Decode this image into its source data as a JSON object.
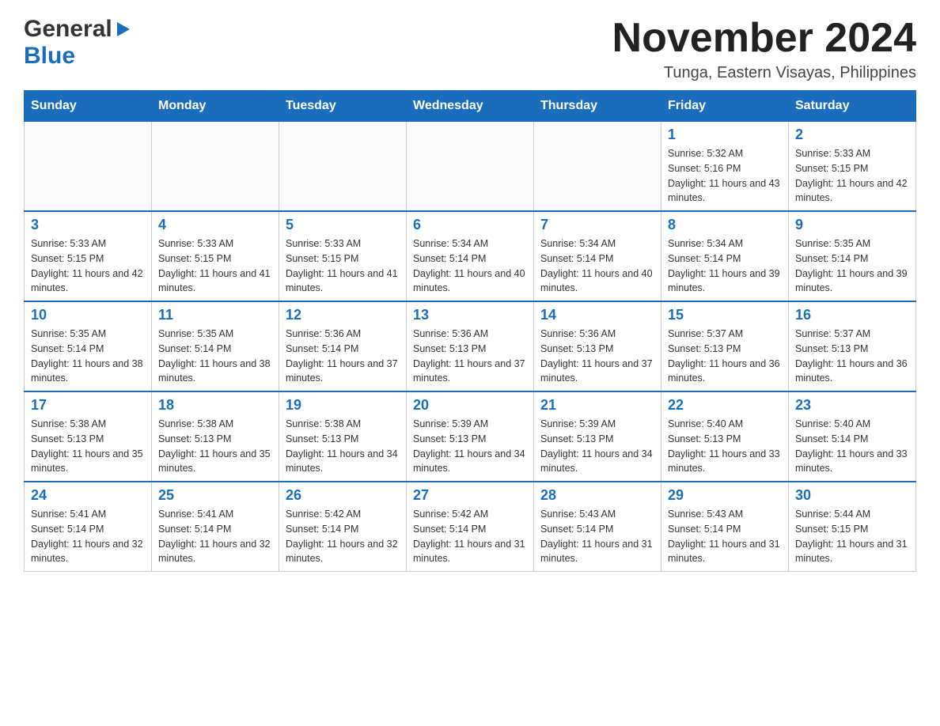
{
  "logo": {
    "general": "General",
    "blue": "Blue",
    "triangle": "▶"
  },
  "header": {
    "month_title": "November 2024",
    "location": "Tunga, Eastern Visayas, Philippines"
  },
  "weekdays": [
    "Sunday",
    "Monday",
    "Tuesday",
    "Wednesday",
    "Thursday",
    "Friday",
    "Saturday"
  ],
  "weeks": [
    [
      {
        "day": "",
        "info": ""
      },
      {
        "day": "",
        "info": ""
      },
      {
        "day": "",
        "info": ""
      },
      {
        "day": "",
        "info": ""
      },
      {
        "day": "",
        "info": ""
      },
      {
        "day": "1",
        "info": "Sunrise: 5:32 AM\nSunset: 5:16 PM\nDaylight: 11 hours and 43 minutes."
      },
      {
        "day": "2",
        "info": "Sunrise: 5:33 AM\nSunset: 5:15 PM\nDaylight: 11 hours and 42 minutes."
      }
    ],
    [
      {
        "day": "3",
        "info": "Sunrise: 5:33 AM\nSunset: 5:15 PM\nDaylight: 11 hours and 42 minutes."
      },
      {
        "day": "4",
        "info": "Sunrise: 5:33 AM\nSunset: 5:15 PM\nDaylight: 11 hours and 41 minutes."
      },
      {
        "day": "5",
        "info": "Sunrise: 5:33 AM\nSunset: 5:15 PM\nDaylight: 11 hours and 41 minutes."
      },
      {
        "day": "6",
        "info": "Sunrise: 5:34 AM\nSunset: 5:14 PM\nDaylight: 11 hours and 40 minutes."
      },
      {
        "day": "7",
        "info": "Sunrise: 5:34 AM\nSunset: 5:14 PM\nDaylight: 11 hours and 40 minutes."
      },
      {
        "day": "8",
        "info": "Sunrise: 5:34 AM\nSunset: 5:14 PM\nDaylight: 11 hours and 39 minutes."
      },
      {
        "day": "9",
        "info": "Sunrise: 5:35 AM\nSunset: 5:14 PM\nDaylight: 11 hours and 39 minutes."
      }
    ],
    [
      {
        "day": "10",
        "info": "Sunrise: 5:35 AM\nSunset: 5:14 PM\nDaylight: 11 hours and 38 minutes."
      },
      {
        "day": "11",
        "info": "Sunrise: 5:35 AM\nSunset: 5:14 PM\nDaylight: 11 hours and 38 minutes."
      },
      {
        "day": "12",
        "info": "Sunrise: 5:36 AM\nSunset: 5:14 PM\nDaylight: 11 hours and 37 minutes."
      },
      {
        "day": "13",
        "info": "Sunrise: 5:36 AM\nSunset: 5:13 PM\nDaylight: 11 hours and 37 minutes."
      },
      {
        "day": "14",
        "info": "Sunrise: 5:36 AM\nSunset: 5:13 PM\nDaylight: 11 hours and 37 minutes."
      },
      {
        "day": "15",
        "info": "Sunrise: 5:37 AM\nSunset: 5:13 PM\nDaylight: 11 hours and 36 minutes."
      },
      {
        "day": "16",
        "info": "Sunrise: 5:37 AM\nSunset: 5:13 PM\nDaylight: 11 hours and 36 minutes."
      }
    ],
    [
      {
        "day": "17",
        "info": "Sunrise: 5:38 AM\nSunset: 5:13 PM\nDaylight: 11 hours and 35 minutes."
      },
      {
        "day": "18",
        "info": "Sunrise: 5:38 AM\nSunset: 5:13 PM\nDaylight: 11 hours and 35 minutes."
      },
      {
        "day": "19",
        "info": "Sunrise: 5:38 AM\nSunset: 5:13 PM\nDaylight: 11 hours and 34 minutes."
      },
      {
        "day": "20",
        "info": "Sunrise: 5:39 AM\nSunset: 5:13 PM\nDaylight: 11 hours and 34 minutes."
      },
      {
        "day": "21",
        "info": "Sunrise: 5:39 AM\nSunset: 5:13 PM\nDaylight: 11 hours and 34 minutes."
      },
      {
        "day": "22",
        "info": "Sunrise: 5:40 AM\nSunset: 5:13 PM\nDaylight: 11 hours and 33 minutes."
      },
      {
        "day": "23",
        "info": "Sunrise: 5:40 AM\nSunset: 5:14 PM\nDaylight: 11 hours and 33 minutes."
      }
    ],
    [
      {
        "day": "24",
        "info": "Sunrise: 5:41 AM\nSunset: 5:14 PM\nDaylight: 11 hours and 32 minutes."
      },
      {
        "day": "25",
        "info": "Sunrise: 5:41 AM\nSunset: 5:14 PM\nDaylight: 11 hours and 32 minutes."
      },
      {
        "day": "26",
        "info": "Sunrise: 5:42 AM\nSunset: 5:14 PM\nDaylight: 11 hours and 32 minutes."
      },
      {
        "day": "27",
        "info": "Sunrise: 5:42 AM\nSunset: 5:14 PM\nDaylight: 11 hours and 31 minutes."
      },
      {
        "day": "28",
        "info": "Sunrise: 5:43 AM\nSunset: 5:14 PM\nDaylight: 11 hours and 31 minutes."
      },
      {
        "day": "29",
        "info": "Sunrise: 5:43 AM\nSunset: 5:14 PM\nDaylight: 11 hours and 31 minutes."
      },
      {
        "day": "30",
        "info": "Sunrise: 5:44 AM\nSunset: 5:15 PM\nDaylight: 11 hours and 31 minutes."
      }
    ]
  ]
}
